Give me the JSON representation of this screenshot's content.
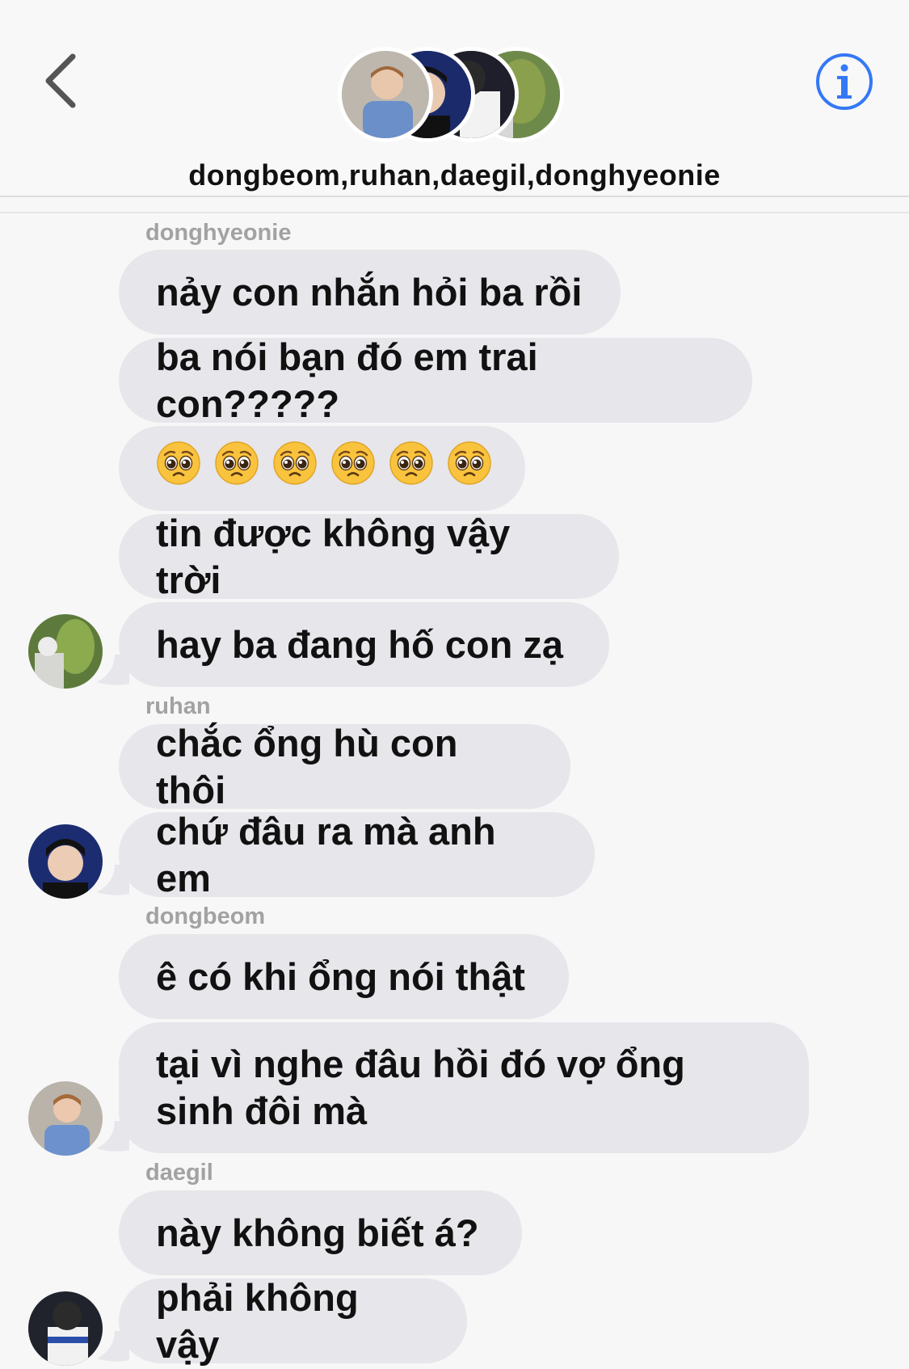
{
  "header": {
    "title": "dongbeom,ruhan,daegil,donghyeonie",
    "back_icon": "chevron-left-icon",
    "info_icon": "info-circle-icon",
    "accent_color": "#3478f6"
  },
  "messages": [
    {
      "sender": "donghyeonie",
      "text": "nảy con nhắn hỏi ba rồi"
    },
    {
      "text": "ba nói bạn đó em trai con?????"
    },
    {
      "emoji": "pleading-face",
      "count": 6
    },
    {
      "text": "tin được không vậy trời"
    },
    {
      "text": "hay ba đang hố con zạ"
    },
    {
      "sender": "ruhan",
      "text": "chắc ổng hù con thôi"
    },
    {
      "text": "chứ đâu ra mà anh em"
    },
    {
      "sender": "dongbeom",
      "text": "ê có khi ổng nói thật"
    },
    {
      "text": "tại vì nghe đâu hồi đó vợ ổng sinh đôi mà"
    },
    {
      "sender": "daegil",
      "text": "này không biết á?"
    },
    {
      "text": "phải không vậy"
    }
  ],
  "colors": {
    "bubble": "#e6e6eb",
    "sender_name": "#a2a2a2",
    "background": "#f7f7f7"
  }
}
